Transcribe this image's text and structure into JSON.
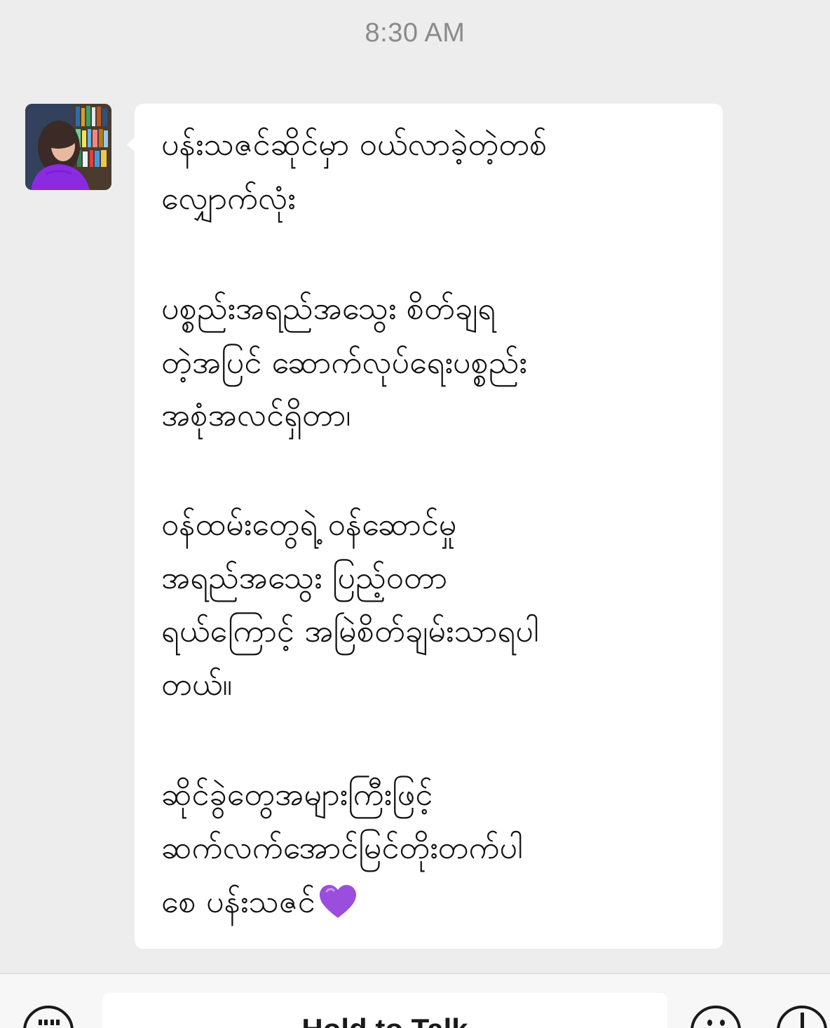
{
  "timestamp": "8:30 AM",
  "message": {
    "lines": [
      "ပန်းသဇင်ဆိုင်မှာ ဝယ်လာခဲ့တဲ့တစ်",
      "လျှောက်လုံး",
      "ပစ္စည်းအရည်အသွေး စိတ်ချရ",
      "တဲ့အပြင် ဆောက်လုပ်ရေးပစ္စည်း",
      "အစုံအလင်ရှိတာ၊",
      "ဝန်ထမ်းတွေရဲ့ ဝန်ဆောင်မှု",
      "အရည်အသွေး ပြည့်ဝတာ",
      "ရယ်ကြောင့် အမြဲစိတ်ချမ်းသာရပါ",
      "တယ်။",
      "ဆိုင်ခွဲတွေအများကြီးဖြင့်",
      "ဆက်လက်အောင်မြင်တိုးတက်ပါ",
      "စေ ပန်းသဇင်"
    ],
    "emoji": "purple-heart"
  },
  "input_bar": {
    "hold_to_talk_label": "Hold to Talk",
    "keyboard_icon": "keyboard-icon",
    "emoji_icon": "emoji-face-icon",
    "plus_icon": "plus-icon"
  },
  "colors": {
    "background": "#ededed",
    "bubble": "#ffffff",
    "timestamp": "#8a8a8a",
    "heart": "#9b4dde"
  }
}
